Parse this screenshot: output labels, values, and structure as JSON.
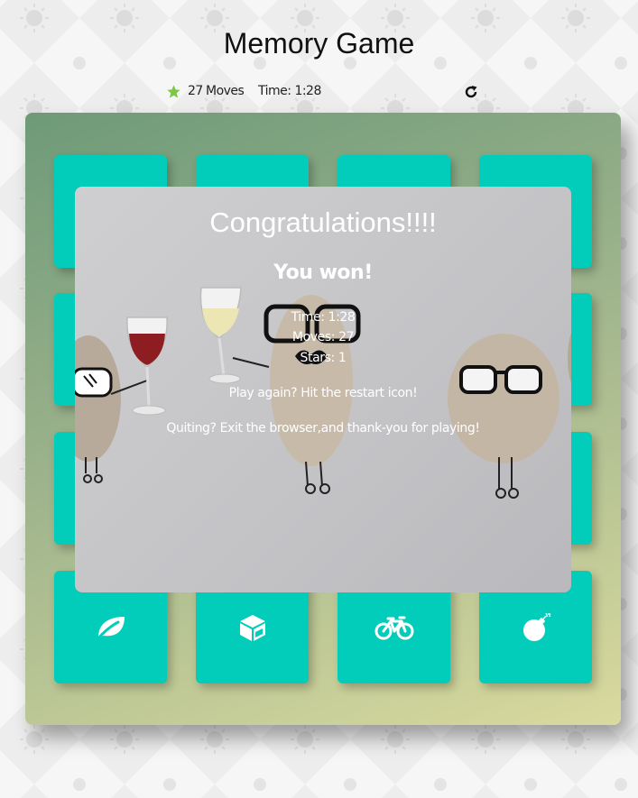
{
  "header": {
    "title": "Memory Game"
  },
  "score_panel": {
    "star_count": 1,
    "moves_count": "27",
    "moves_label": "Moves",
    "time_label": "Time:",
    "time_value": "1:28"
  },
  "deck": {
    "visible_cards": [
      {
        "icon": "leaf-icon",
        "state": "open"
      },
      {
        "icon": "cube-icon",
        "state": "open"
      },
      {
        "icon": "bicycle-icon",
        "state": "open"
      },
      {
        "icon": "bomb-icon",
        "state": "open"
      }
    ]
  },
  "modal": {
    "title": "Congratulations!!!!",
    "subtitle": "You won!",
    "time_line": "Time: 1:28",
    "moves_line": "Moves: 27",
    "stars_line": "Stars: 1",
    "play_again": "Play again? Hit the restart icon!",
    "quit": "Quiting? Exit the browser,and thank-you for playing!"
  },
  "colors": {
    "card": "#02ccba",
    "star": "#7ac943",
    "deck_gradient_start": "#6e9a78",
    "deck_gradient_end": "#d9da9e"
  }
}
